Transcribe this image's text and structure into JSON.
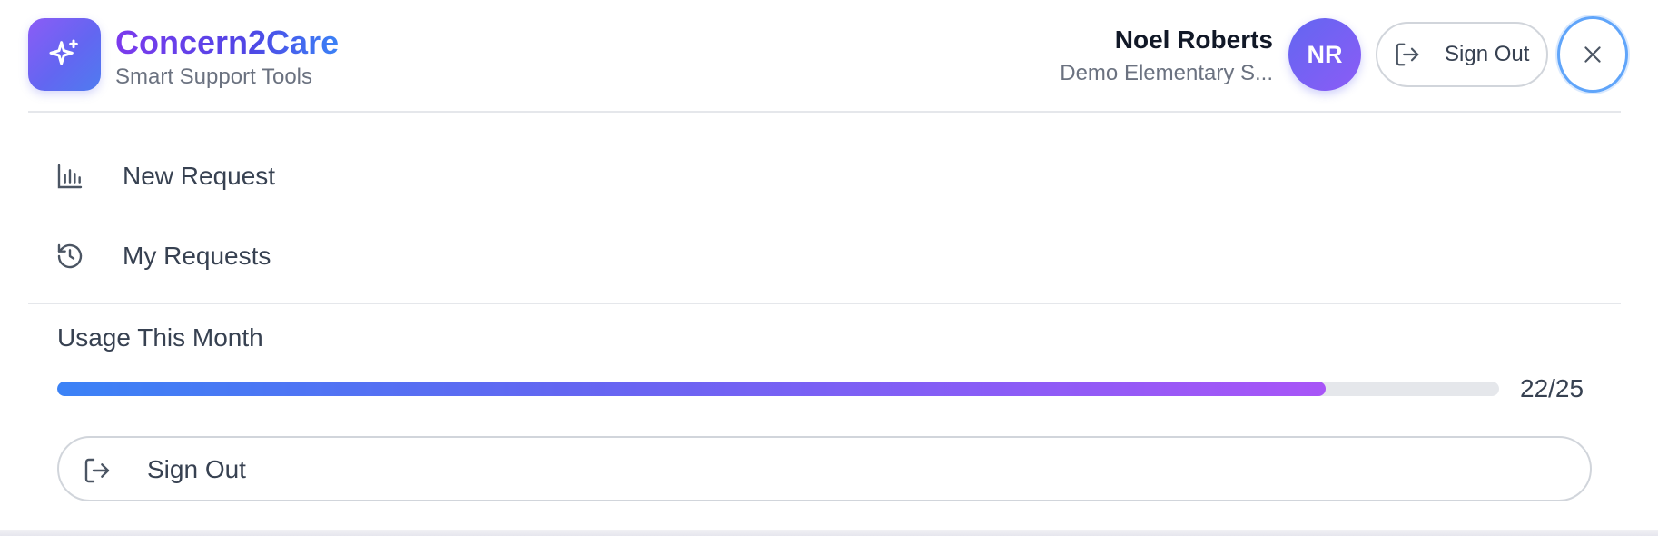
{
  "brand": {
    "title": "Concern2Care",
    "subtitle": "Smart Support Tools",
    "icon": "sparkles-icon"
  },
  "user": {
    "name": "Noel Roberts",
    "school": "Demo Elementary S...",
    "initials": "NR"
  },
  "header": {
    "signout_label": "Sign Out",
    "close_icon": "close-icon"
  },
  "nav": {
    "items": [
      {
        "label": "New Request",
        "icon": "bar-chart-icon"
      },
      {
        "label": "My Requests",
        "icon": "history-icon"
      }
    ]
  },
  "usage": {
    "title": "Usage This Month",
    "used": 22,
    "limit": 25,
    "count_text": "22/25"
  },
  "footer": {
    "signout_label": "Sign Out"
  },
  "colors": {
    "brand_gradient_start": "#8b5cf6",
    "brand_gradient_end": "#4f7bf0",
    "progress_start": "#3b82f6",
    "progress_end": "#a855f7",
    "focus_ring": "#60a5fa"
  }
}
